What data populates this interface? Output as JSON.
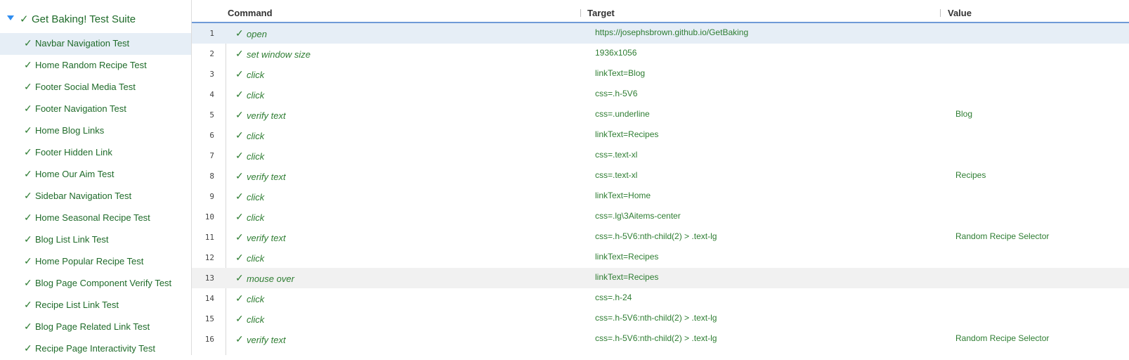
{
  "suite": {
    "name": "Get Baking! Test Suite",
    "check": "✓"
  },
  "tests": [
    {
      "label": "Navbar Navigation Test",
      "selected": true
    },
    {
      "label": "Home Random Recipe Test"
    },
    {
      "label": "Footer Social Media Test"
    },
    {
      "label": "Footer Navigation Test"
    },
    {
      "label": "Home Blog Links"
    },
    {
      "label": "Footer Hidden Link"
    },
    {
      "label": "Home Our Aim Test"
    },
    {
      "label": "Sidebar Navigation Test"
    },
    {
      "label": "Home Seasonal Recipe Test"
    },
    {
      "label": "Blog List Link Test"
    },
    {
      "label": "Home Popular Recipe Test"
    },
    {
      "label": "Blog Page Component Verify Test"
    },
    {
      "label": "Recipe List Link Test"
    },
    {
      "label": "Blog Page Related Link Test"
    },
    {
      "label": "Recipe Page Interactivity Test"
    }
  ],
  "table": {
    "headers": {
      "command": "Command",
      "target": "Target",
      "value": "Value"
    },
    "rows": [
      {
        "num": "1",
        "command": "open",
        "target": "https://josephsbrown.github.io/GetBaking",
        "value": "",
        "state": "selected"
      },
      {
        "num": "2",
        "command": "set window size",
        "target": "1936x1056",
        "value": ""
      },
      {
        "num": "3",
        "command": "click",
        "target": "linkText=Blog",
        "value": ""
      },
      {
        "num": "4",
        "command": "click",
        "target": "css=.h-5V6",
        "value": ""
      },
      {
        "num": "5",
        "command": "verify text",
        "target": "css=.underline",
        "value": "Blog"
      },
      {
        "num": "6",
        "command": "click",
        "target": "linkText=Recipes",
        "value": ""
      },
      {
        "num": "7",
        "command": "click",
        "target": "css=.text-xl",
        "value": ""
      },
      {
        "num": "8",
        "command": "verify text",
        "target": "css=.text-xl",
        "value": "Recipes"
      },
      {
        "num": "9",
        "command": "click",
        "target": "linkText=Home",
        "value": ""
      },
      {
        "num": "10",
        "command": "click",
        "target": "css=.lg\\3Aitems-center",
        "value": ""
      },
      {
        "num": "11",
        "command": "verify text",
        "target": "css=.h-5V6:nth-child(2) > .text-lg",
        "value": "Random Recipe Selector"
      },
      {
        "num": "12",
        "command": "click",
        "target": "linkText=Recipes",
        "value": ""
      },
      {
        "num": "13",
        "command": "mouse over",
        "target": "linkText=Recipes",
        "value": "",
        "state": "hovered"
      },
      {
        "num": "14",
        "command": "click",
        "target": "css=.h-24",
        "value": ""
      },
      {
        "num": "15",
        "command": "click",
        "target": "css=.h-5V6:nth-child(2) > .text-lg",
        "value": ""
      },
      {
        "num": "16",
        "command": "verify text",
        "target": "css=.h-5V6:nth-child(2) > .text-lg",
        "value": "Random Recipe Selector"
      }
    ]
  },
  "colors": {
    "pass_green": "#2e7d32",
    "selected_row": "#e6eef6",
    "hover_row": "#f1f1f1",
    "header_underline": "#6f9ad6",
    "caret_blue": "#2f8df0"
  },
  "icons": {
    "suite_caret": "chevron-down-icon",
    "pass_mark": "check-icon"
  }
}
